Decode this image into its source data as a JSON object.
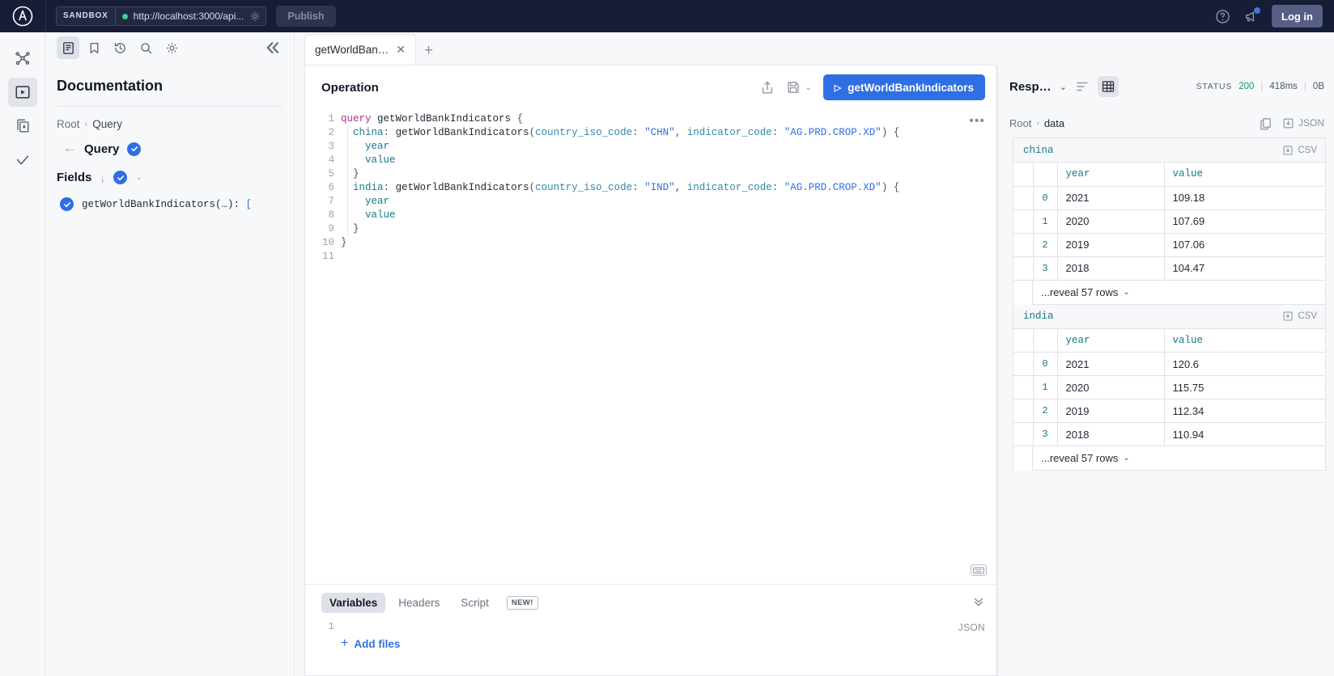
{
  "topbar": {
    "sandbox_label": "SANDBOX",
    "endpoint_url": "http://localhost:3000/api...",
    "publish_label": "Publish",
    "login_label": "Log in",
    "icons": {
      "logo": "apollo-logo",
      "gear": "gear-icon",
      "help": "help-icon",
      "megaphone": "megaphone-icon"
    }
  },
  "rail": {
    "items": [
      {
        "name": "schema-graph-icon",
        "label": "Schema"
      },
      {
        "name": "explorer-icon",
        "label": "Explorer",
        "active": true
      },
      {
        "name": "persisted-queries-icon",
        "label": "Persisted Queries"
      },
      {
        "name": "checks-icon",
        "label": "Checks"
      }
    ]
  },
  "docs": {
    "toolbar": [
      {
        "name": "documentation-icon",
        "active": true
      },
      {
        "name": "bookmark-icon",
        "active": false
      },
      {
        "name": "history-icon",
        "active": false
      },
      {
        "name": "search-icon",
        "active": false
      },
      {
        "name": "settings-gear-icon",
        "active": false
      }
    ],
    "collapse_icon": "chevron-double-left-icon",
    "title": "Documentation",
    "breadcrumb": {
      "root": "Root",
      "separator": "›",
      "current": "Query"
    },
    "query_row": {
      "back": "←",
      "name": "Query"
    },
    "fields": {
      "label": "Fields",
      "sort_arrow": "↓",
      "caret": "⌄"
    },
    "field_items": [
      {
        "signature": "getWorldBankIndicators(…): ",
        "return_type": "["
      }
    ]
  },
  "tabs": {
    "items": [
      {
        "label": "getWorldBan…",
        "close": "✕",
        "active": true
      }
    ],
    "add_label": "+"
  },
  "operation": {
    "title": "Operation",
    "share_icon": "share-icon",
    "save_icon": "save-icon",
    "save_caret": "⌄",
    "run_button": {
      "label": "getWorldBankIndicators",
      "play": "▷"
    },
    "more_icon": "•••",
    "keyboard_icon": "keyboard-icon",
    "line_numbers": [
      "1",
      "2",
      "3",
      "4",
      "5",
      "6",
      "7",
      "8",
      "9",
      "10",
      "11"
    ],
    "code_lines": [
      {
        "n": 1,
        "tokens": [
          {
            "t": "kw",
            "v": "query"
          },
          {
            "t": "sp",
            "v": " "
          },
          {
            "t": "opname",
            "v": "getWorldBankIndicators"
          },
          {
            "t": "sp",
            "v": " "
          },
          {
            "t": "punc",
            "v": "{"
          }
        ]
      },
      {
        "n": 2,
        "tokens": [
          {
            "t": "sp",
            "v": "  "
          },
          {
            "t": "alias",
            "v": "china"
          },
          {
            "t": "punc",
            "v": ":"
          },
          {
            "t": "sp",
            "v": " "
          },
          {
            "t": "fname",
            "v": "getWorldBankIndicators"
          },
          {
            "t": "punc",
            "v": "("
          },
          {
            "t": "arg",
            "v": "country_iso_code"
          },
          {
            "t": "punc",
            "v": ":"
          },
          {
            "t": "sp",
            "v": " "
          },
          {
            "t": "str",
            "v": "\"CHN\""
          },
          {
            "t": "punc",
            "v": ","
          },
          {
            "t": "sp",
            "v": " "
          },
          {
            "t": "arg",
            "v": "indicator_code"
          },
          {
            "t": "punc",
            "v": ":"
          },
          {
            "t": "sp",
            "v": " "
          },
          {
            "t": "str",
            "v": "\"AG.PRD.CROP.XD\""
          },
          {
            "t": "punc",
            "v": ")"
          },
          {
            "t": "sp",
            "v": " "
          },
          {
            "t": "punc",
            "v": "{"
          }
        ]
      },
      {
        "n": 3,
        "tokens": [
          {
            "t": "sp",
            "v": "    "
          },
          {
            "t": "fld",
            "v": "year"
          }
        ]
      },
      {
        "n": 4,
        "tokens": [
          {
            "t": "sp",
            "v": "    "
          },
          {
            "t": "fld",
            "v": "value"
          }
        ]
      },
      {
        "n": 5,
        "tokens": [
          {
            "t": "sp",
            "v": "  "
          },
          {
            "t": "punc",
            "v": "}"
          }
        ]
      },
      {
        "n": 6,
        "tokens": [
          {
            "t": "sp",
            "v": "  "
          },
          {
            "t": "alias",
            "v": "india"
          },
          {
            "t": "punc",
            "v": ":"
          },
          {
            "t": "sp",
            "v": " "
          },
          {
            "t": "fname",
            "v": "getWorldBankIndicators"
          },
          {
            "t": "punc",
            "v": "("
          },
          {
            "t": "arg",
            "v": "country_iso_code"
          },
          {
            "t": "punc",
            "v": ":"
          },
          {
            "t": "sp",
            "v": " "
          },
          {
            "t": "str",
            "v": "\"IND\""
          },
          {
            "t": "punc",
            "v": ","
          },
          {
            "t": "sp",
            "v": " "
          },
          {
            "t": "arg",
            "v": "indicator_code"
          },
          {
            "t": "punc",
            "v": ":"
          },
          {
            "t": "sp",
            "v": " "
          },
          {
            "t": "str",
            "v": "\"AG.PRD.CROP.XD\""
          },
          {
            "t": "punc",
            "v": ")"
          },
          {
            "t": "sp",
            "v": " "
          },
          {
            "t": "punc",
            "v": "{"
          }
        ]
      },
      {
        "n": 7,
        "tokens": [
          {
            "t": "sp",
            "v": "    "
          },
          {
            "t": "fld",
            "v": "year"
          }
        ]
      },
      {
        "n": 8,
        "tokens": [
          {
            "t": "sp",
            "v": "    "
          },
          {
            "t": "fld",
            "v": "value"
          }
        ]
      },
      {
        "n": 9,
        "tokens": [
          {
            "t": "sp",
            "v": "  "
          },
          {
            "t": "punc",
            "v": "}"
          }
        ]
      },
      {
        "n": 10,
        "tokens": [
          {
            "t": "punc",
            "v": "}"
          }
        ]
      },
      {
        "n": 11,
        "tokens": []
      }
    ]
  },
  "bottom_panel": {
    "tabs": [
      {
        "label": "Variables",
        "active": true
      },
      {
        "label": "Headers",
        "active": false
      },
      {
        "label": "Script",
        "active": false,
        "badge": "NEW!"
      }
    ],
    "collapse_icon": "chevron-double-down-icon",
    "line_number": "1",
    "add_files_label": "Add files",
    "add_files_plus": "+",
    "format_label": "JSON"
  },
  "response": {
    "title": "Resp…",
    "caret": "⌄",
    "format_icon": "format-lines-icon",
    "table_view_icon": "table-view-icon",
    "status_label": "STATUS",
    "status_code": "200",
    "duration": "418ms",
    "size": "0B",
    "breadcrumb": {
      "root": "Root",
      "separator": "›",
      "current": "data"
    },
    "copy_icon": "copy-icon",
    "download_icon": "download-icon",
    "json_label": "JSON",
    "csv_label": "CSV",
    "columns": [
      "year",
      "value"
    ],
    "tables": [
      {
        "name": "china",
        "rows": [
          {
            "idx": "0",
            "year": "2021",
            "value": "109.18"
          },
          {
            "idx": "1",
            "year": "2020",
            "value": "107.69"
          },
          {
            "idx": "2",
            "year": "2019",
            "value": "107.06"
          },
          {
            "idx": "3",
            "year": "2018",
            "value": "104.47"
          }
        ],
        "reveal_label": "...reveal 57 rows"
      },
      {
        "name": "india",
        "rows": [
          {
            "idx": "0",
            "year": "2021",
            "value": "120.6"
          },
          {
            "idx": "1",
            "year": "2020",
            "value": "115.75"
          },
          {
            "idx": "2",
            "year": "2019",
            "value": "112.34"
          },
          {
            "idx": "3",
            "year": "2018",
            "value": "110.94"
          }
        ],
        "reveal_label": "...reveal 57 rows"
      }
    ]
  },
  "colors": {
    "topbar_bg": "#181d37",
    "accent": "#2f6fe4",
    "status_green": "#0f9d58",
    "panel_bg": "#f7f8fa",
    "border": "#e4e6eb",
    "mono_teal": "#17788a"
  }
}
